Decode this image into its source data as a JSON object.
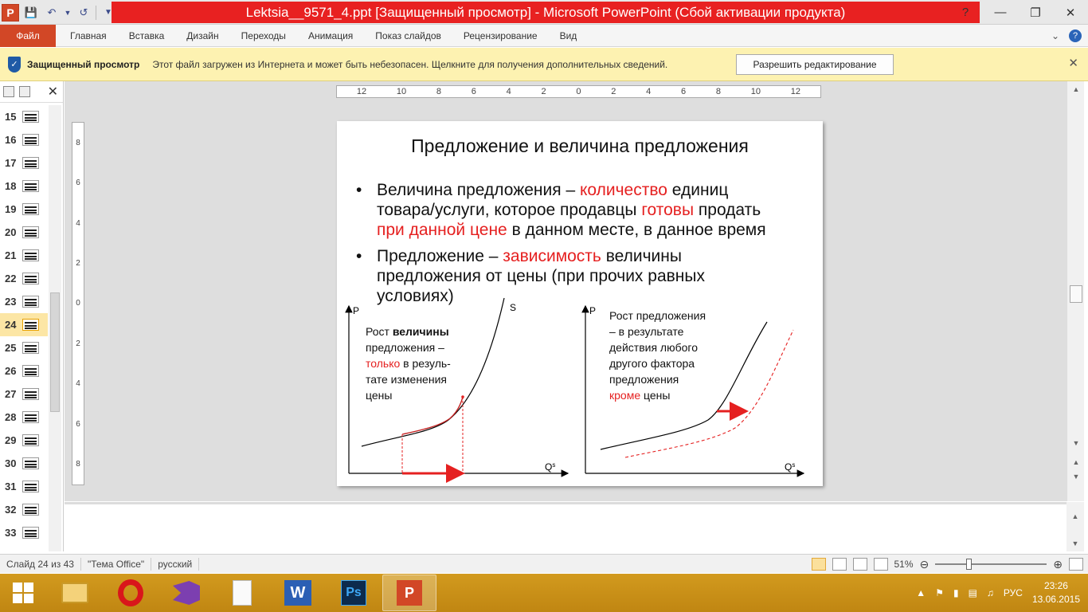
{
  "window": {
    "title": "Lektsia__9571_4.ppt [Защищенный просмотр] - Microsoft PowerPoint (Сбой активации продукта)",
    "app_logo": "P"
  },
  "menu": {
    "file_label": "Файл",
    "items": [
      "Главная",
      "Вставка",
      "Дизайн",
      "Переходы",
      "Анимация",
      "Показ слайдов",
      "Рецензирование",
      "Вид"
    ]
  },
  "protected_view": {
    "title": "Защищенный просмотр",
    "message": "Этот файл загружен из Интернета и может быть небезопасен. Щелкните для получения дополнительных сведений.",
    "button": "Разрешить редактирование"
  },
  "thumbnails": {
    "items": [
      "15",
      "16",
      "17",
      "18",
      "19",
      "20",
      "21",
      "22",
      "23",
      "24",
      "25",
      "26",
      "27",
      "28",
      "29",
      "30",
      "31",
      "32",
      "33"
    ],
    "selected": "24"
  },
  "rulers": {
    "horizontal": [
      "12",
      "10",
      "8",
      "6",
      "4",
      "2",
      "0",
      "2",
      "4",
      "6",
      "8",
      "10",
      "12"
    ],
    "vertical": [
      "8",
      "6",
      "4",
      "2",
      "0",
      "2",
      "4",
      "6",
      "8"
    ]
  },
  "slide": {
    "title": "Предложение и величина предложения",
    "bullet1": {
      "l1a": "Величина предложения – ",
      "l1b": "количество",
      "l1c": " единиц",
      "l2a": "товара/услуги, которое продавцы ",
      "l2b": "готовы",
      "l2c": " продать",
      "l3a": "при данной цене",
      "l3b": " в данном месте, в данное время"
    },
    "bullet2": {
      "l1a": "Предложение – ",
      "l1b": "зависимость",
      "l1c": " величины",
      "l2": "предложения от цены (при прочих равных",
      "l3": "условиях)"
    },
    "left_chart": {
      "y_label": "P",
      "x_label": "Q",
      "x_sup": "s",
      "curve_label": "S",
      "text": {
        "l1a": "Рост ",
        "l1b": "величины",
        "l2": "предложения  –",
        "l3a": "только",
        "l3b": " в резуль-",
        "l4": "тате изменения",
        "l5": "цены"
      }
    },
    "right_chart": {
      "y_label": "P",
      "x_label": "Q",
      "x_sup": "s",
      "text": {
        "l1": "Рост   предложения",
        "l2": "– в результате",
        "l3": "действия любого",
        "l4": "другого фактора",
        "l5": "предложения",
        "l6a": "кроме",
        "l6b": "  цены"
      }
    }
  },
  "status": {
    "slide_info": "Слайд 24 из 43",
    "theme": "\"Тема Office\"",
    "language": "русский",
    "zoom": "51%",
    "zoom_fraction": 0.29
  },
  "taskbar": {
    "apps": [
      "file-explorer",
      "opera",
      "visual-studio",
      "document",
      "word",
      "photoshop",
      "powerpoint"
    ],
    "active": "powerpoint",
    "lang": "РУС",
    "time": "23:26",
    "date": "13.06.2015"
  },
  "colors": {
    "accent_red": "#e52020",
    "title_red": "#e82121",
    "file_tab": "#d24726",
    "protected_bg": "#fdf2b1",
    "taskbar": "#c88e16"
  }
}
